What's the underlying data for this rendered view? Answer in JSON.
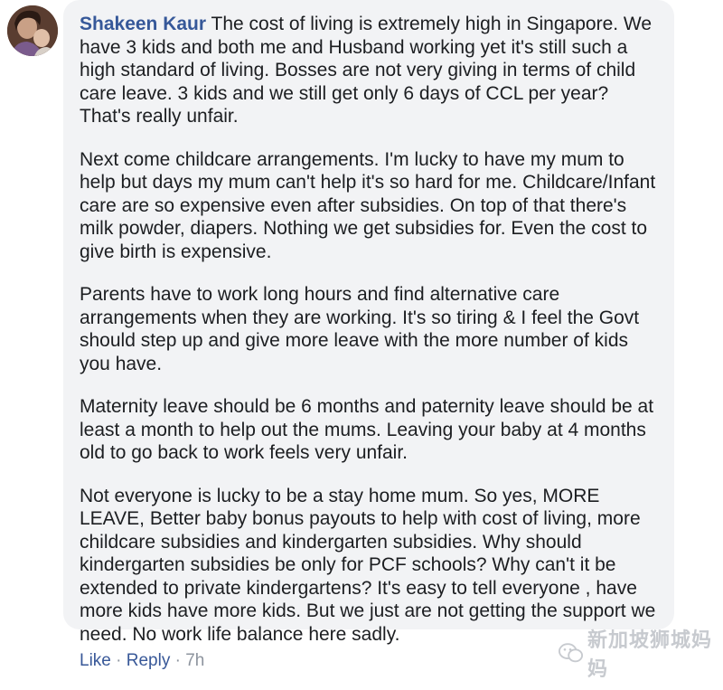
{
  "comment": {
    "author": "Shakeen Kaur",
    "paragraphs": [
      "The cost of living is extremely high in Singapore. We have 3 kids and both me and Husband working yet it's still such a high standard of living. Bosses are not very giving in terms of child care leave. 3 kids and we still get only 6 days of CCL per year? That's really unfair.",
      "Next come childcare arrangements. I'm lucky to have my mum to help but days my mum can't help it's so hard for me. Childcare/Infant care are so expensive even after subsidies. On top of that there's milk powder, diapers. Nothing we get subsidies for. Even the cost to give birth is expensive.",
      "Parents have to work long hours and find alternative care arrangements when they are working. It's so tiring & I feel the Govt should step up and give more leave with the more number of kids you have.",
      "Maternity leave should be 6 months and paternity leave should be at least a month to help out the mums. Leaving your baby at 4 months old to go back to work feels very unfair.",
      "Not everyone is lucky to be a stay home mum. So yes, MORE LEAVE, Better baby bonus payouts to help with cost of living, more childcare subsidies and kindergarten subsidies. Why should kindergarten subsidies be only for PCF schools? Why can't it be extended to private kindergartens? It's easy to tell everyone , have more kids have more kids. But we just are not getting the support we need. No work life balance here sadly."
    ]
  },
  "actions": {
    "like": "Like",
    "separator": "·",
    "reply": "Reply",
    "time": "7h"
  },
  "watermark": {
    "text": "新加坡狮城妈妈"
  },
  "colors": {
    "author": "#365899",
    "link": "#385898",
    "bubble": "#f2f3f5",
    "body_text": "#1c1e21",
    "muted": "#8d949e"
  }
}
